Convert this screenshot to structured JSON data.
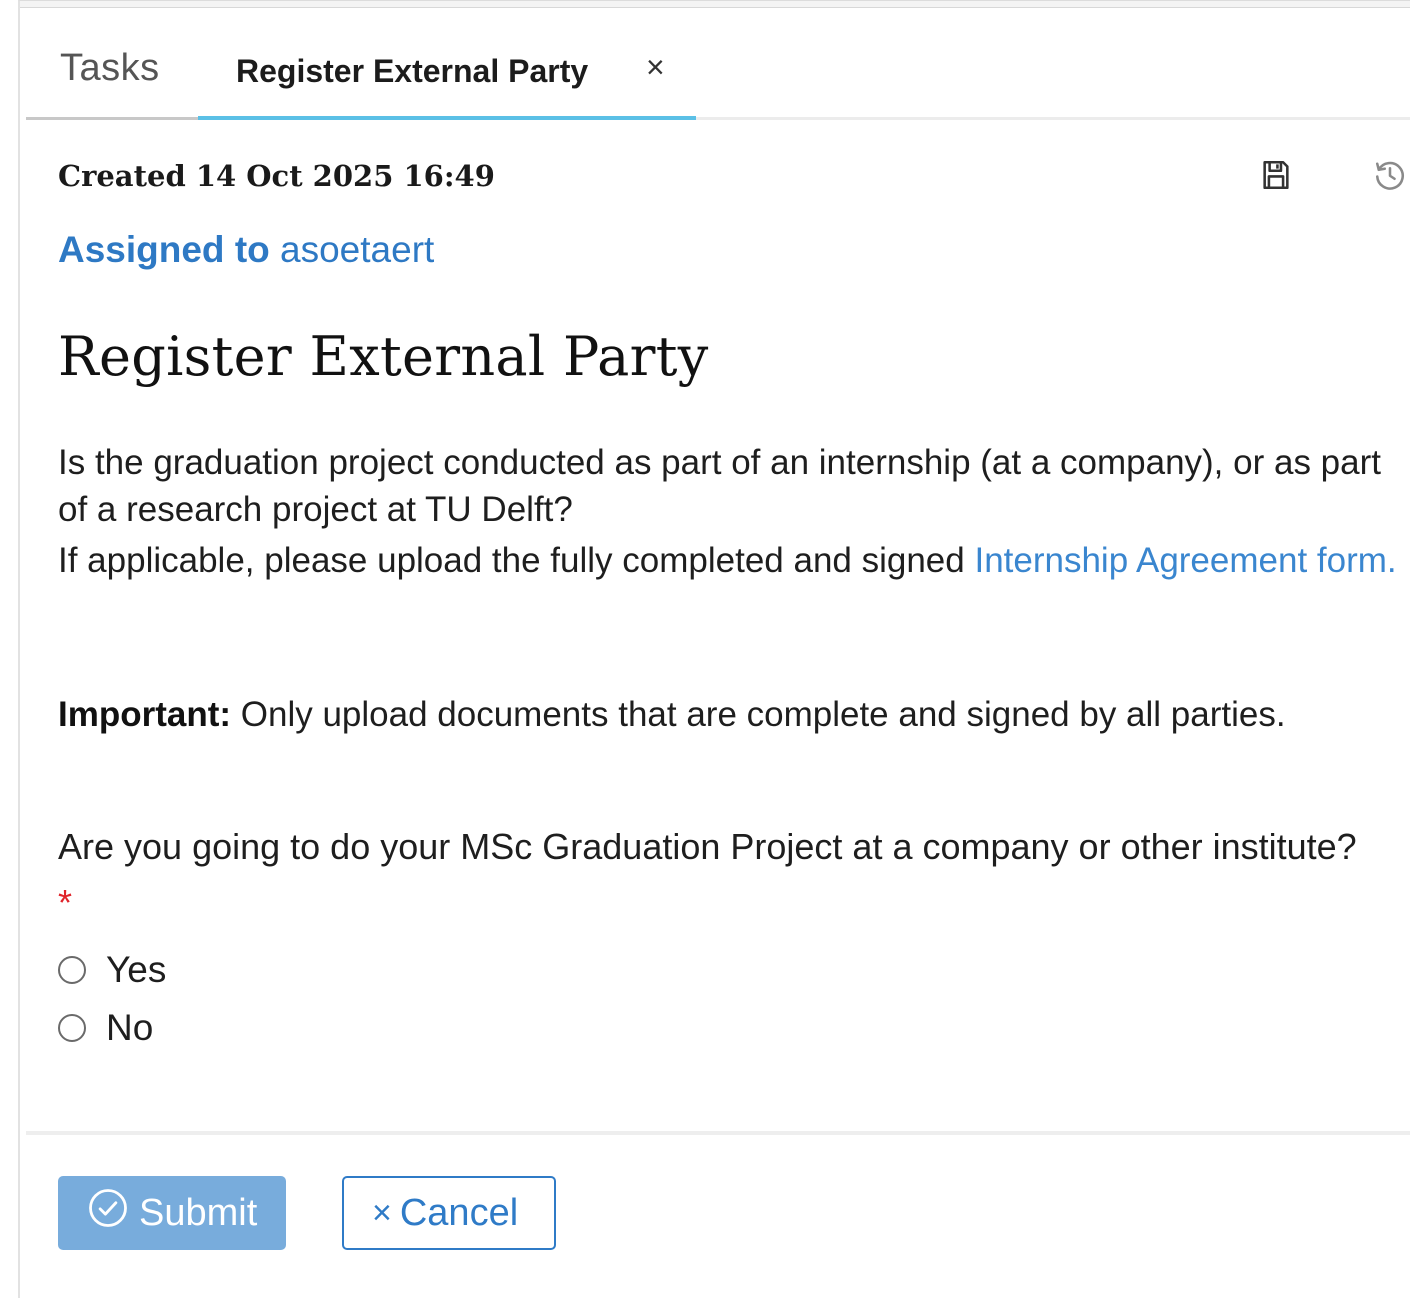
{
  "tabs": {
    "tasks_label": "Tasks",
    "active_label": "Register External Party",
    "close_glyph": "×"
  },
  "meta": {
    "created": "Created 14 Oct 2025 16:49",
    "assigned_label": "Assigned to",
    "assigned_user": "asoetaert"
  },
  "icons": {
    "save": "save-icon",
    "history": "history-icon"
  },
  "page": {
    "title": "Register External Party",
    "desc_line1": "Is the graduation project conducted as part of an internship (at a company), or as part of a research project at TU Delft?",
    "desc_line2_prefix": "If applicable, please upload the fully completed and signed ",
    "desc_link": "Internship Agreement form.",
    "important_label": "Important:",
    "important_text": " Only upload documents that are complete and signed by all parties.",
    "question": "Are you going to do your MSc Graduation Project at a company or other institute?",
    "required_marker": "*"
  },
  "options": {
    "yes": "Yes",
    "no": "No"
  },
  "buttons": {
    "submit_label": "Submit",
    "cancel_label": "Cancel",
    "cancel_glyph": "×"
  },
  "colors": {
    "accent": "#2e79c4",
    "tab_underline": "#5bc0e6",
    "submit_bg": "#78acdc",
    "required": "#e0242a"
  }
}
